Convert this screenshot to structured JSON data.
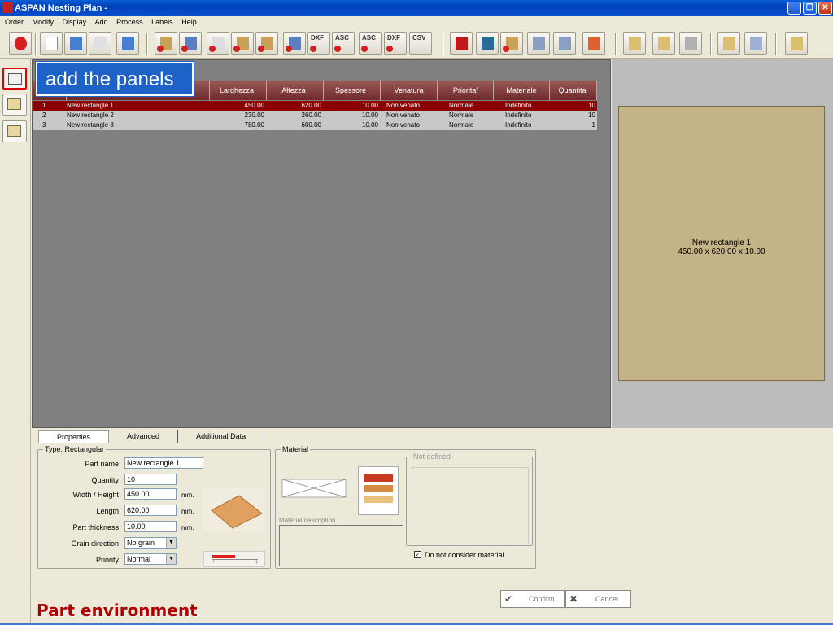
{
  "window": {
    "title": "ASPAN Nesting Plan -"
  },
  "menu": [
    "Order",
    "Modify",
    "Display",
    "Add",
    "Process",
    "Labels",
    "Help"
  ],
  "toolbar_text_icons": [
    "DXF",
    "ASC",
    "ASC",
    "DXF",
    "CSV"
  ],
  "callout": "add the panels",
  "grid": {
    "columns": [
      "",
      "",
      "Larghezza",
      "Altezza",
      "Spessore",
      "Venatura",
      "Priorita'",
      "Materiale",
      "Quantita'"
    ],
    "rows": [
      {
        "n": "1",
        "name": "New rectangle 1",
        "w": "450.00",
        "h": "620.00",
        "t": "10.00",
        "grain": "Non venato",
        "priority": "Normale",
        "material": "Indefinito",
        "qty": "10"
      },
      {
        "n": "2",
        "name": "New rectangle 2",
        "w": "230.00",
        "h": "260.00",
        "t": "10.00",
        "grain": "Non venato",
        "priority": "Normale",
        "material": "Indefinito",
        "qty": "10"
      },
      {
        "n": "3",
        "name": "New rectangle 3",
        "w": "780.00",
        "h": "600.00",
        "t": "10.00",
        "grain": "Non venato",
        "priority": "Normale",
        "material": "Indefinito",
        "qty": "1"
      }
    ]
  },
  "preview": {
    "name": "New rectangle 1",
    "dims": "450.00 x 620.00 x 10.00",
    "color": "#c4b386"
  },
  "tabs": [
    "Properties",
    "Advanced",
    "Additional Data"
  ],
  "properties": {
    "group_label": "Type: Rectangular",
    "part_name_label": "Part name",
    "part_name": "New rectangle 1",
    "quantity_label": "Quantity",
    "quantity": "10",
    "width_label": "Width / Height",
    "width": "450.00",
    "length_label": "Length",
    "length": "620.00",
    "thickness_label": "Part thickness",
    "thickness": "10.00",
    "unit": "mm.",
    "grain_label": "Grain direction",
    "grain": "No grain",
    "priority_label": "Priority",
    "priority": "Normal",
    "scale_min": "0",
    "scale_max": "1"
  },
  "material": {
    "group_label": "Material",
    "desc_label": "Material description",
    "not_defined_label": "Not defined",
    "ignore_label": "Do not consider material"
  },
  "buttons": {
    "confirm": "Confirm",
    "cancel": "Cancel"
  },
  "footer_title": "Part environment"
}
